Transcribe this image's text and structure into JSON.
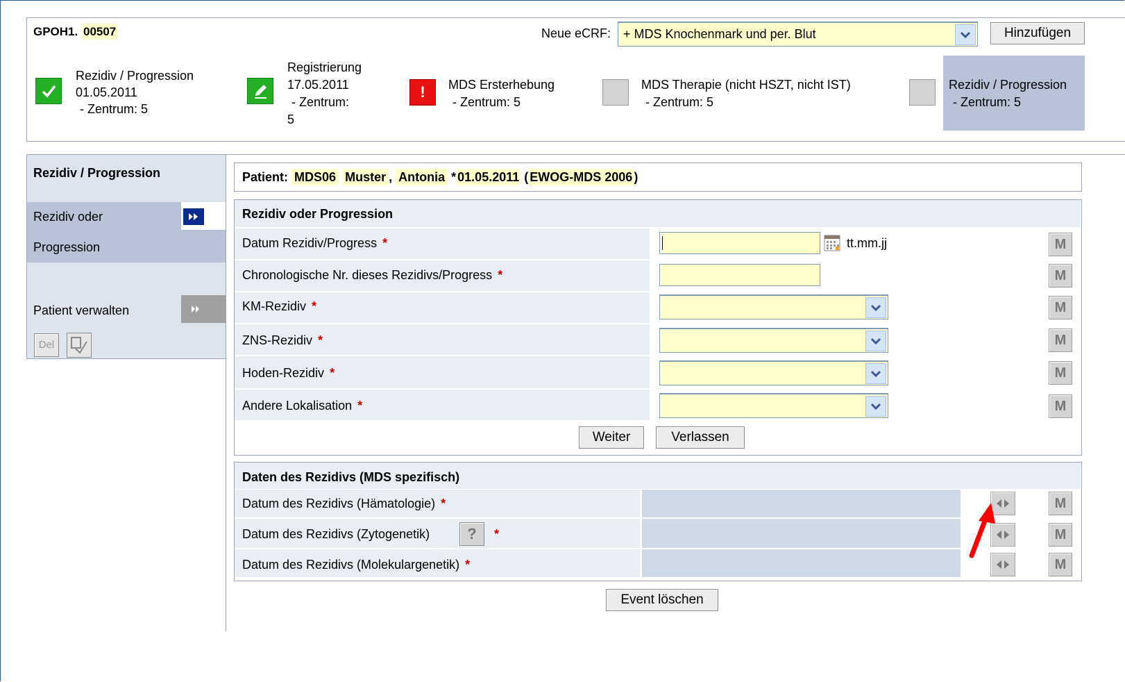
{
  "top": {
    "case_prefix": "GPOH1.",
    "case_id": "00507",
    "new_ecrf_label": "Neue eCRF:",
    "new_ecrf_value": "+ MDS Knochenmark und per. Blut",
    "add_button": "Hinzufügen"
  },
  "timeline": [
    {
      "status": "done",
      "lines": [
        "Rezidiv / Progression",
        "01.05.2011",
        "- Zentrum: 5"
      ]
    },
    {
      "status": "edit",
      "lines": [
        "Registrierung",
        "17.05.2011",
        "- Zentrum:",
        "5"
      ]
    },
    {
      "status": "error",
      "lines": [
        "MDS Ersterhebung",
        "- Zentrum: 5"
      ]
    },
    {
      "status": "empty",
      "lines": [
        "MDS Therapie (nicht HSZT, nicht IST)",
        "- Zentrum: 5"
      ]
    },
    {
      "status": "active",
      "lines": [
        "Rezidiv / Progression",
        "- Zentrum: 5"
      ]
    }
  ],
  "sidebar": {
    "title": "Rezidiv / Progression",
    "item1_line1": "Rezidiv oder",
    "item1_line2": "Progression",
    "item2": "Patient verwalten",
    "del_button": "Del"
  },
  "patient": {
    "label": "Patient:",
    "id": "MDS06",
    "last_name": "Muster",
    "comma": ",",
    "first_name": "Antonia",
    "dob_prefix": "*",
    "dob": "01.05.2011",
    "paren_open": "(",
    "study": "EWOG-MDS 2006",
    "paren_close": ")"
  },
  "form1": {
    "title": "Rezidiv oder Progression",
    "date_hint": "tt.mm.jj",
    "fields": [
      {
        "label": "Datum Rezidiv/Progress",
        "type": "date",
        "value": ""
      },
      {
        "label": "Chronologische Nr. dieses Rezidivs/Progress",
        "type": "text",
        "value": ""
      },
      {
        "label": "KM-Rezidiv",
        "type": "select",
        "value": ""
      },
      {
        "label": "ZNS-Rezidiv",
        "type": "select",
        "value": ""
      },
      {
        "label": "Hoden-Rezidiv",
        "type": "select",
        "value": ""
      },
      {
        "label": "Andere Lokalisation",
        "type": "select",
        "value": ""
      }
    ],
    "required_mark": "*",
    "m_label": "M",
    "next_button": "Weiter",
    "leave_button": "Verlassen"
  },
  "form2": {
    "title": "Daten des Rezidivs (MDS spezifisch)",
    "fields": [
      {
        "label": "Datum des Rezidivs (Hämatologie)"
      },
      {
        "label": "Datum des Rezidivs (Zytogenetik)",
        "help": "?"
      },
      {
        "label": "Datum des Rezidivs (Molekulargenetik)"
      }
    ],
    "delete_event_button": "Event löschen"
  },
  "colors": {
    "highlight": "#ffffcc",
    "panel": "#e9edf4",
    "sidebar_active": "#b8c3d7",
    "accent": "#1f3f9a",
    "annotation_arrow": "#ff0000"
  }
}
